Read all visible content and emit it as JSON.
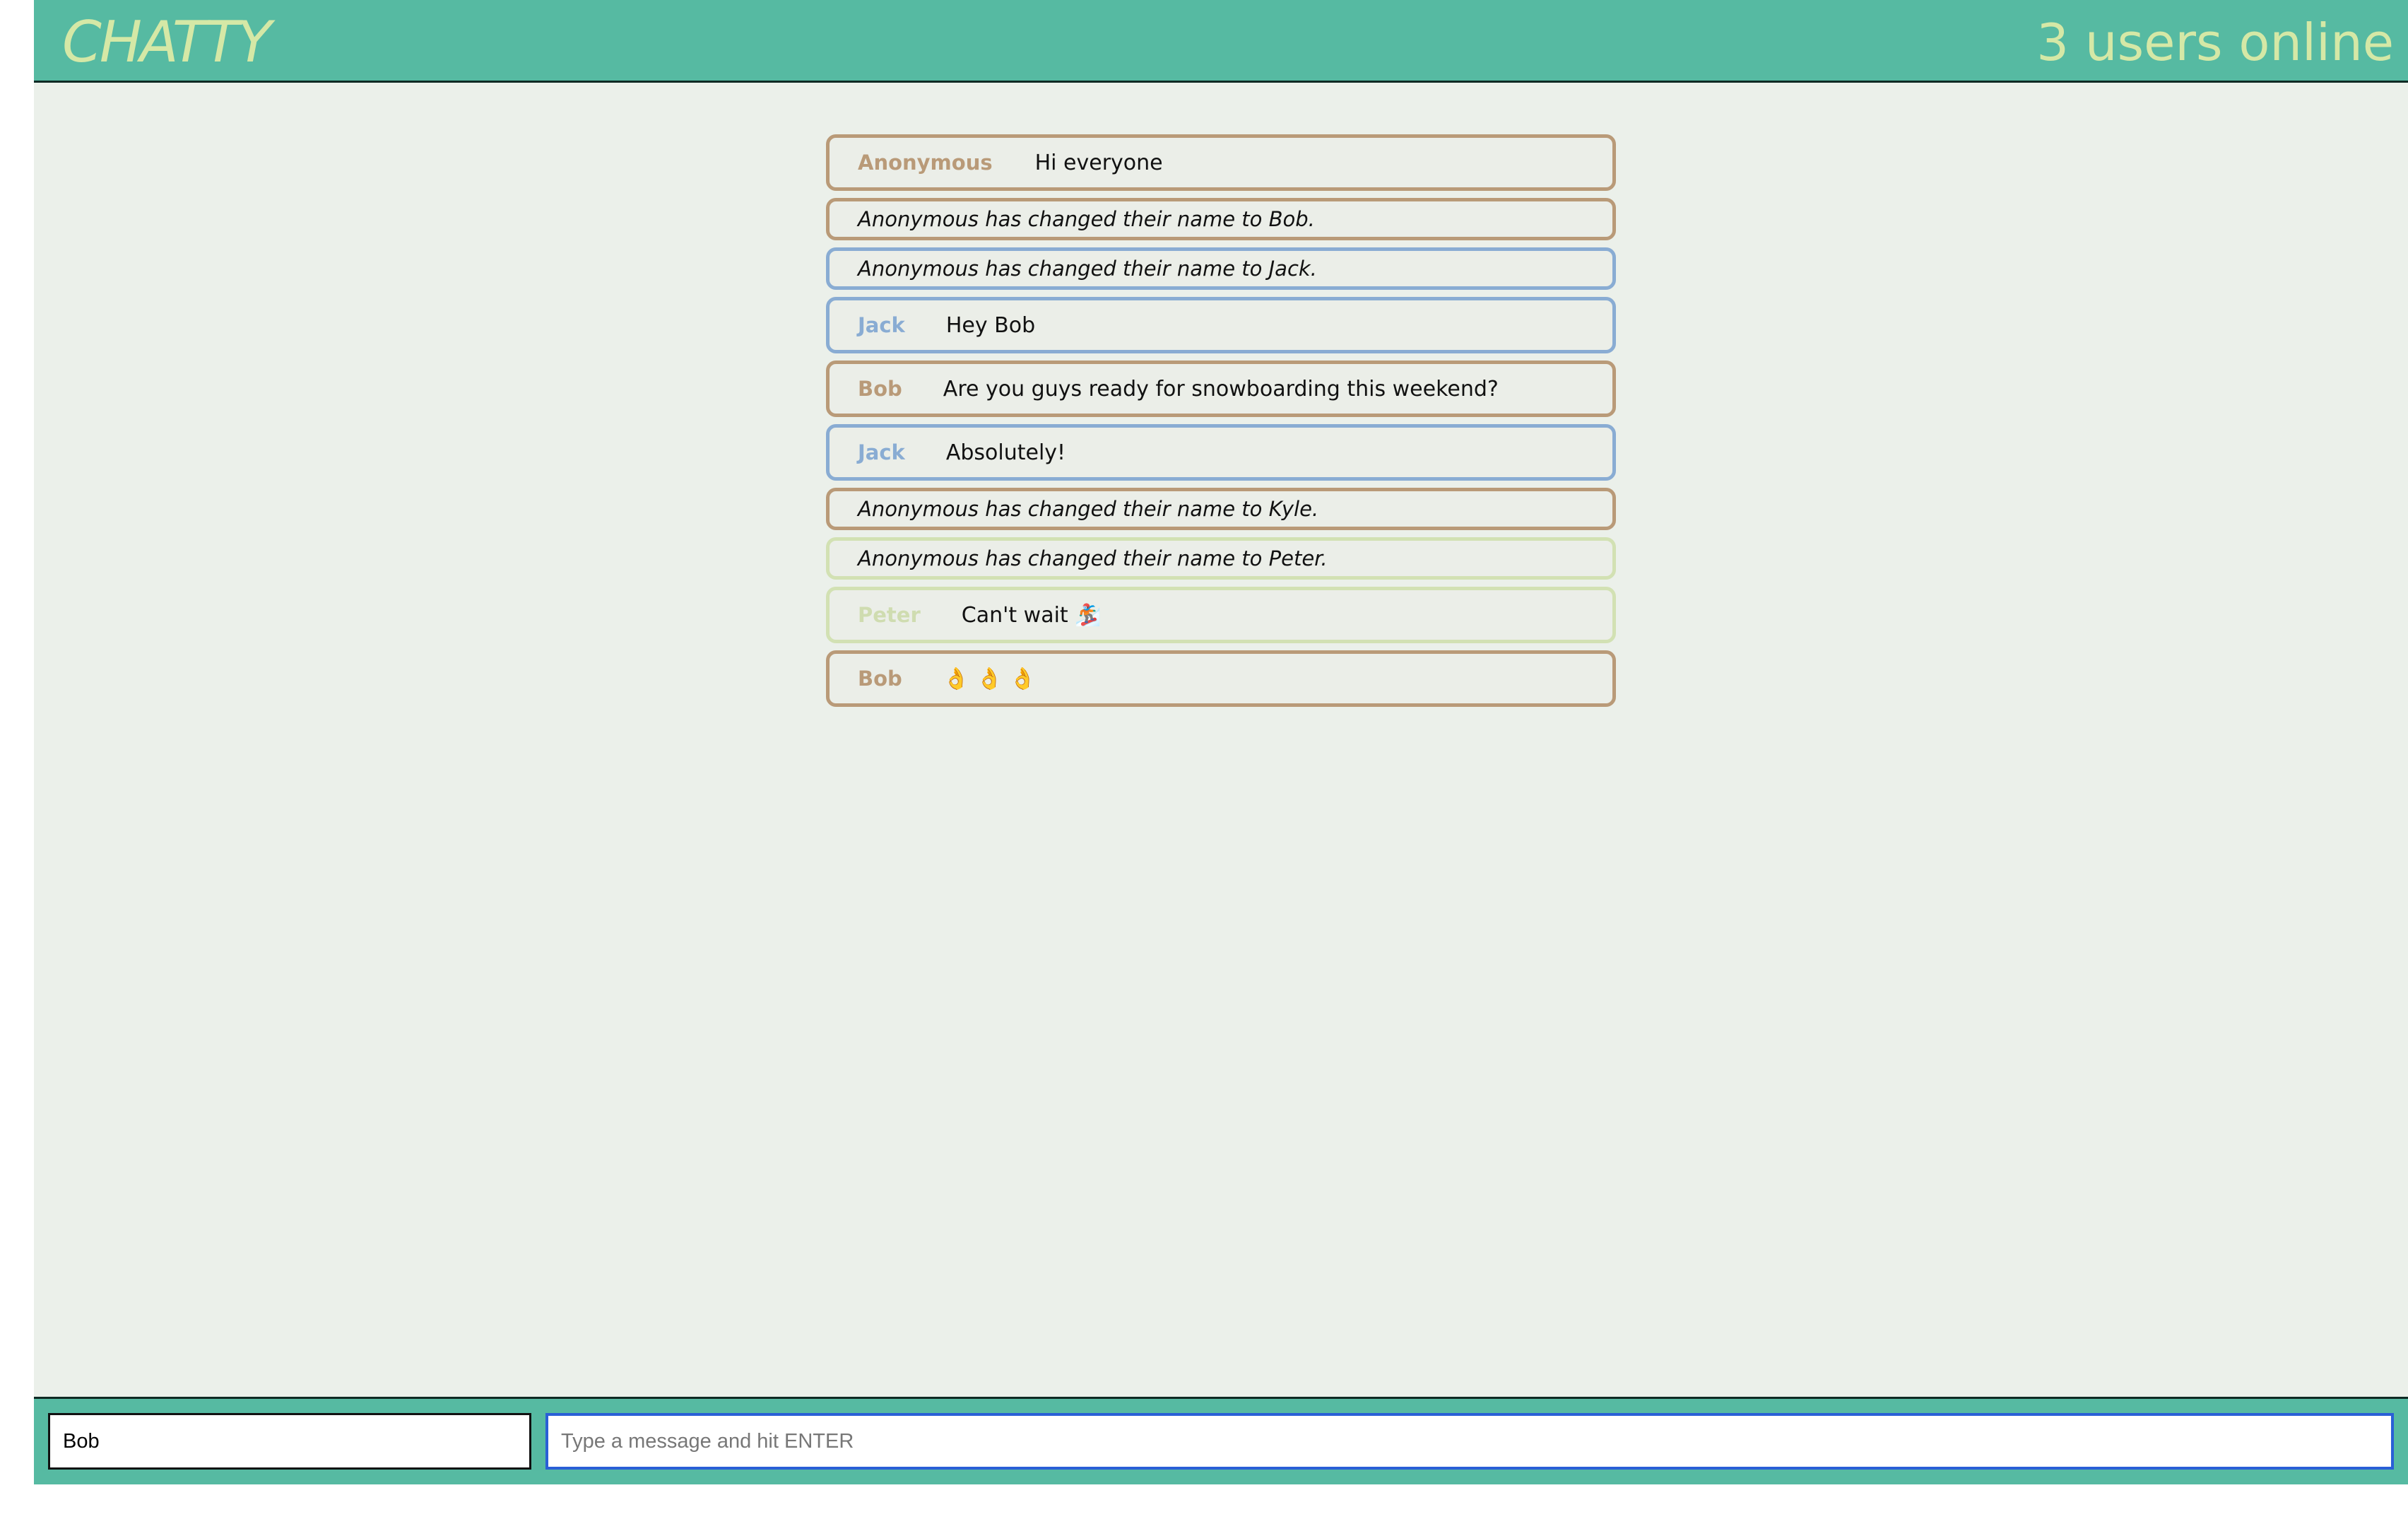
{
  "navbar": {
    "brand": "CHATTY",
    "users_online": "3 users online"
  },
  "messages": [
    {
      "type": "message",
      "user": "Anonymous",
      "text": "Hi everyone",
      "color": "brown"
    },
    {
      "type": "notice",
      "text": "Anonymous has changed their name to Bob.",
      "color": "brown"
    },
    {
      "type": "notice",
      "text": "Anonymous has changed their name to Jack.",
      "color": "blue"
    },
    {
      "type": "message",
      "user": "Jack",
      "text": "Hey Bob",
      "color": "blue"
    },
    {
      "type": "message",
      "user": "Bob",
      "text": "Are you guys ready for snowboarding this weekend?",
      "color": "brown"
    },
    {
      "type": "message",
      "user": "Jack",
      "text": "Absolutely!",
      "color": "blue"
    },
    {
      "type": "notice",
      "text": "Anonymous has changed their name to Kyle.",
      "color": "brown"
    },
    {
      "type": "notice",
      "text": "Anonymous has changed their name to Peter.",
      "color": "green"
    },
    {
      "type": "message",
      "user": "Peter",
      "text": "Can't wait 🏂",
      "color": "green"
    },
    {
      "type": "message",
      "user": "Bob",
      "text": "👌 👌 👌",
      "color": "brown"
    }
  ],
  "footer": {
    "username_value": "Bob",
    "message_placeholder": "Type a message and hit ENTER",
    "message_value": ""
  },
  "colors": {
    "navbar_bg": "#56baa2",
    "brand_text": "#d5e8a6",
    "page_bg": "#ebf0ea",
    "brown": "#b99a78",
    "blue": "#89acd3",
    "green": "#d2e1b3",
    "input_focus": "#2a5fd6"
  }
}
